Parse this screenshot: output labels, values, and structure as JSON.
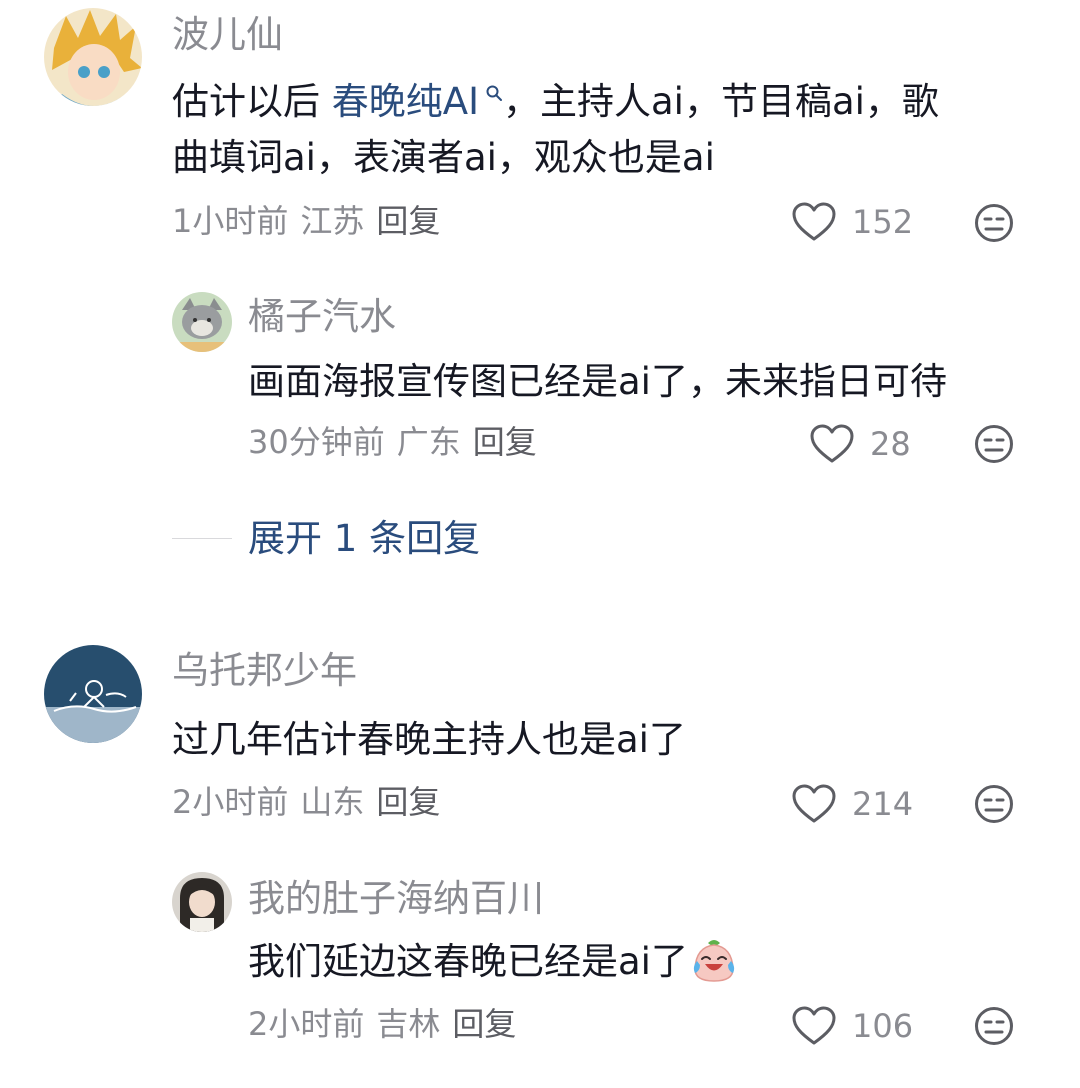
{
  "comments": [
    {
      "username": "波儿仙",
      "content_prefix": "估计以后 ",
      "topic_link": "春晚纯AI",
      "content_line1_rest": "，主持人ai，节目稿ai，歌",
      "content_line2": "曲填词ai，表演者ai，观众也是ai",
      "time": "1小时前",
      "location": "江苏",
      "reply_label": "回复",
      "likes": "152",
      "replies": [
        {
          "username": "橘子汽水",
          "content": "画面海报宣传图已经是ai了，未来指日可待",
          "time": "30分钟前",
          "location": "广东",
          "reply_label": "回复",
          "likes": "28"
        }
      ],
      "expand_label": "展开 1 条回复"
    },
    {
      "username": "乌托邦少年",
      "content": "过几年估计春晚主持人也是ai了",
      "time": "2小时前",
      "location": "山东",
      "reply_label": "回复",
      "likes": "214",
      "replies": [
        {
          "username": "我的肚子海纳百川",
          "content": "我们延边这春晚已经是ai了",
          "emoji": "crying-laughing-emoji",
          "time": "2小时前",
          "location": "吉林",
          "reply_label": "回复",
          "likes": "106"
        }
      ]
    }
  ],
  "icons": {
    "like": "heart-outline-icon",
    "dislike": "unamused-face-icon",
    "topic_search": "search-icon"
  },
  "colors": {
    "text_primary": "#161823",
    "text_secondary": "#8a8b91",
    "link": "#2a4c7d",
    "background": "#ffffff"
  }
}
